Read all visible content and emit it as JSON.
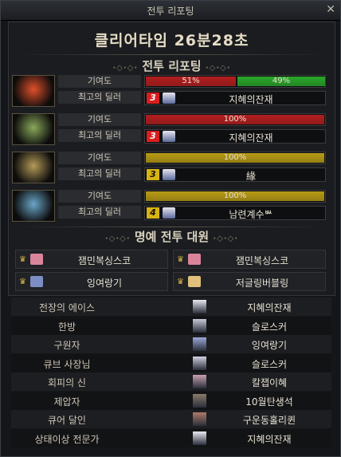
{
  "window": {
    "title": "전투 리포팅",
    "close_icon": "✕"
  },
  "clear_time": "클리어타임  26분28초",
  "battle_report": {
    "header": "전투 리포팅"
  },
  "labels": {
    "contribution": "기여도",
    "top_dealer": "최고의 딜러"
  },
  "bosses": [
    {
      "portrait_icon": "red-demon-portrait",
      "segments": [
        {
          "pct": 51,
          "label": "51%",
          "color": "#b21e1e"
        },
        {
          "pct": 49,
          "label": "49%",
          "color": "#2aa62a"
        }
      ],
      "rank": "3",
      "rank_color": "#d81e1e",
      "dealer": "지혜의잔재"
    },
    {
      "portrait_icon": "green-demon-portrait",
      "segments": [
        {
          "pct": 100,
          "label": "100%",
          "color": "#b21e1e"
        }
      ],
      "rank": "3",
      "rank_color": "#d81e1e",
      "dealer": "지혜의잔재"
    },
    {
      "portrait_icon": "gold-demon-portrait",
      "segments": [
        {
          "pct": 100,
          "label": "100%",
          "color": "#b79a14"
        }
      ],
      "rank": "3",
      "rank_color": "#d7b416",
      "dealer": "緣"
    },
    {
      "portrait_icon": "blue-demon-portrait",
      "segments": [
        {
          "pct": 100,
          "label": "100%",
          "color": "#b79a14"
        }
      ],
      "rank": "4",
      "rank_color": "#d7b416",
      "dealer": "남련계수ᄥ"
    }
  ],
  "honor_party": {
    "header": "명예 전투 대원",
    "members": [
      "잼민복싱스코",
      "잼민복싱스코",
      "잉여랑기",
      "저글링버블링"
    ]
  },
  "awards": [
    {
      "title": "전장의 에이스",
      "name": "지혜의잔재"
    },
    {
      "title": "한방",
      "name": "슬로스커"
    },
    {
      "title": "구원자",
      "name": "잉여랑기"
    },
    {
      "title": "큐브 사장님",
      "name": "슬로스커"
    },
    {
      "title": "회피의 신",
      "name": "칼잽이혜"
    },
    {
      "title": "제압자",
      "name": "10월탄생석"
    },
    {
      "title": "큐어 달인",
      "name": "구운동홀리퀸"
    },
    {
      "title": "상태이상 전문가",
      "name": "지혜의잔재"
    }
  ]
}
